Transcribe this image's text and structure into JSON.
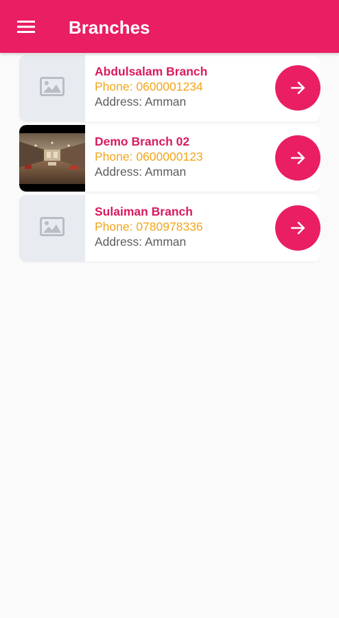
{
  "app_bar": {
    "title": "Branches",
    "menu_icon": "hamburger-menu-icon",
    "background": "#e91e63"
  },
  "branches": [
    {
      "name": "Abdulsalam Branch",
      "phone": "Phone: 0600001234",
      "address": "Address: Amman",
      "thumbnail": "image-placeholder-icon"
    },
    {
      "name": "Demo Branch 02",
      "phone": "Phone: 0600000123",
      "address": "Address: Amman",
      "thumbnail": "branch-photo"
    },
    {
      "name": "Sulaiman Branch",
      "phone": "Phone: 0780978336",
      "address": "Address: Amman",
      "thumbnail": "image-placeholder-icon"
    }
  ],
  "colors": {
    "accent": "#e91e63",
    "name": "#d81b60",
    "phone": "#f2a519",
    "address": "#5d5d5d",
    "background": "#fafafa"
  },
  "icons": {
    "go": "arrow-right-icon"
  }
}
